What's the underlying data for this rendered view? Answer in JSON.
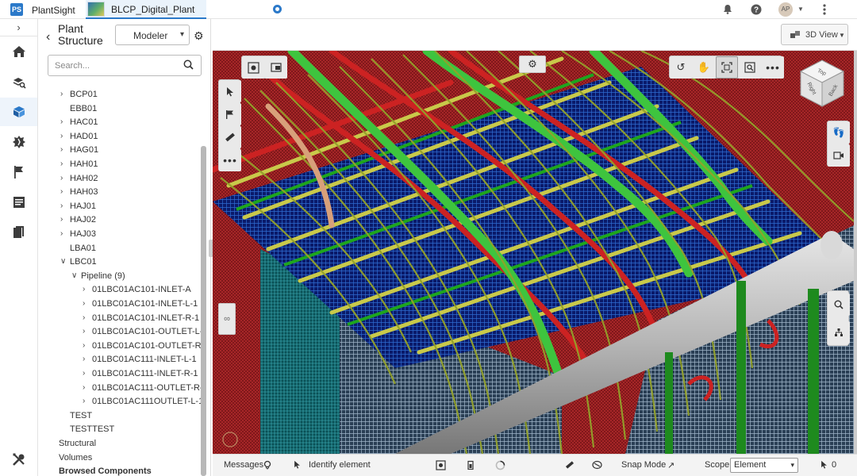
{
  "topbar": {
    "app_name": "PlantSight",
    "tab_name": "BLCP_Digital_Plant",
    "avatar_initials": "AP",
    "accent_color": "#2b79c9"
  },
  "leftnav": {
    "expand_glyph": "›",
    "items": [
      "home-icon",
      "layers-search-icon",
      "cube-icon",
      "broken-gear-icon",
      "flag-icon",
      "document-list-icon",
      "copy-document-icon",
      "tools-icon"
    ]
  },
  "panel": {
    "title": "Plant Structure",
    "mode_select": "Modeler",
    "search_placeholder": "Search...",
    "tree": [
      {
        "label": "BCP01",
        "indent": 0,
        "chevron": "right"
      },
      {
        "label": "EBB01",
        "indent": 0,
        "chevron": "none"
      },
      {
        "label": "HAC01",
        "indent": 0,
        "chevron": "right"
      },
      {
        "label": "HAD01",
        "indent": 0,
        "chevron": "right"
      },
      {
        "label": "HAG01",
        "indent": 0,
        "chevron": "right"
      },
      {
        "label": "HAH01",
        "indent": 0,
        "chevron": "right"
      },
      {
        "label": "HAH02",
        "indent": 0,
        "chevron": "right"
      },
      {
        "label": "HAH03",
        "indent": 0,
        "chevron": "right"
      },
      {
        "label": "HAJ01",
        "indent": 0,
        "chevron": "right"
      },
      {
        "label": "HAJ02",
        "indent": 0,
        "chevron": "right"
      },
      {
        "label": "HAJ03",
        "indent": 0,
        "chevron": "right"
      },
      {
        "label": "LBA01",
        "indent": 0,
        "chevron": "none"
      },
      {
        "label": "LBC01",
        "indent": 0,
        "chevron": "down"
      },
      {
        "label": "Pipeline (9)",
        "indent": 1,
        "chevron": "down"
      },
      {
        "label": "01LBC01AC101-INLET-A",
        "indent": 2,
        "chevron": "right"
      },
      {
        "label": "01LBC01AC101-INLET-L-1",
        "indent": 2,
        "chevron": "right"
      },
      {
        "label": "01LBC01AC101-INLET-R-1",
        "indent": 2,
        "chevron": "right"
      },
      {
        "label": "01LBC01AC101-OUTLET-L-1",
        "indent": 2,
        "chevron": "right"
      },
      {
        "label": "01LBC01AC101-OUTLET-R-1",
        "indent": 2,
        "chevron": "right"
      },
      {
        "label": "01LBC01AC111-INLET-L-1",
        "indent": 2,
        "chevron": "right"
      },
      {
        "label": "01LBC01AC111-INLET-R-1",
        "indent": 2,
        "chevron": "right"
      },
      {
        "label": "01LBC01AC111-OUTLET-R-1",
        "indent": 2,
        "chevron": "right"
      },
      {
        "label": "01LBC01AC111OUTLET-L-1",
        "indent": 2,
        "chevron": "right"
      },
      {
        "label": "TEST",
        "indent": 0,
        "chevron": "none"
      },
      {
        "label": "TESTTEST",
        "indent": 0,
        "chevron": "none"
      },
      {
        "label": "Structural",
        "indent": -1,
        "chevron": "none"
      },
      {
        "label": "Volumes",
        "indent": -1,
        "chevron": "none"
      },
      {
        "label": "Browsed Components",
        "indent": -1,
        "chevron": "none",
        "bold": true
      }
    ]
  },
  "viewport": {
    "view_mode": "3D View",
    "cube_faces": [
      "Top",
      "Right",
      "Back"
    ]
  },
  "statusbar": {
    "messages": "Messages",
    "identify": "Identify element",
    "snap_mode": "Snap Mode",
    "scope_label": "Scope:",
    "scope_value": "Element",
    "selection_count": "0"
  }
}
